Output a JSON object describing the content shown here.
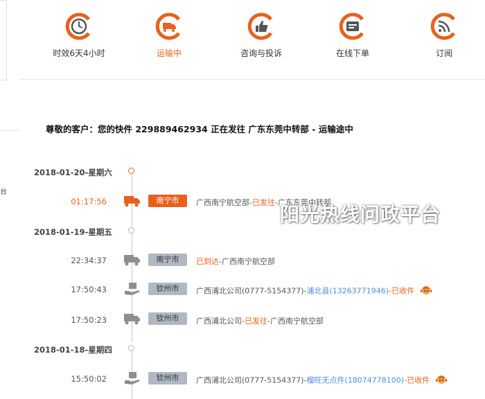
{
  "left": {
    "edge_char": "台"
  },
  "nav": {
    "items": [
      {
        "label": "时效6天4小时",
        "icon": "clock-refresh-icon",
        "active": false
      },
      {
        "label": "运输中",
        "icon": "truck-icon",
        "active": true
      },
      {
        "label": "咨询与投诉",
        "icon": "thumbs-up-icon",
        "active": false
      },
      {
        "label": "在线下单",
        "icon": "card-icon",
        "active": false
      },
      {
        "label": "订阅",
        "icon": "rss-icon",
        "active": false
      }
    ]
  },
  "headline": "尊敬的客户：您的快件 229889462934 正在发往 广东东莞中转部 - 运输途中",
  "timeline": {
    "dates": [
      "2018-01-20-星期六",
      "2018-01-19-星期五",
      "2018-01-18-星期四"
    ],
    "events": [
      {
        "time": "01:17:56",
        "city": "南宁市",
        "icon": "truck-icon",
        "desc_a": "广西南宁航空部-",
        "desc_status": "已发往",
        "desc_b": "-广东东莞中转部"
      },
      {
        "time": "22:34:37",
        "city": "南宁市",
        "icon": "truck-icon",
        "desc_status": "已到达",
        "desc_b": "-广西南宁航空部"
      },
      {
        "time": "17:50:43",
        "city": "钦州市",
        "icon": "courier-pickup-icon",
        "desc_a": "广西浦北公司(0777-5154377)-",
        "desc_link": "浦北县(13263771946)",
        "desc_status": "-已收件"
      },
      {
        "time": "17:50:23",
        "city": "钦州市",
        "icon": "truck-icon",
        "desc_a": "广西浦北公司-",
        "desc_status": "已发往",
        "desc_b": "-广西南宁航空部"
      },
      {
        "time": "15:50:02",
        "city": "钦州市",
        "icon": "courier-pickup-icon",
        "desc_a": "广西浦北公司(0777-5154377)-",
        "desc_link": "榴旺无点件(18074778100)",
        "desc_status": "-已收件"
      }
    ]
  },
  "watermark": "阳光热线问政平台",
  "colors": {
    "accent": "#e8611c",
    "link": "#4a90d9",
    "badge_gray": "#b0b8c2",
    "icon_gray": "#8a8f96"
  }
}
